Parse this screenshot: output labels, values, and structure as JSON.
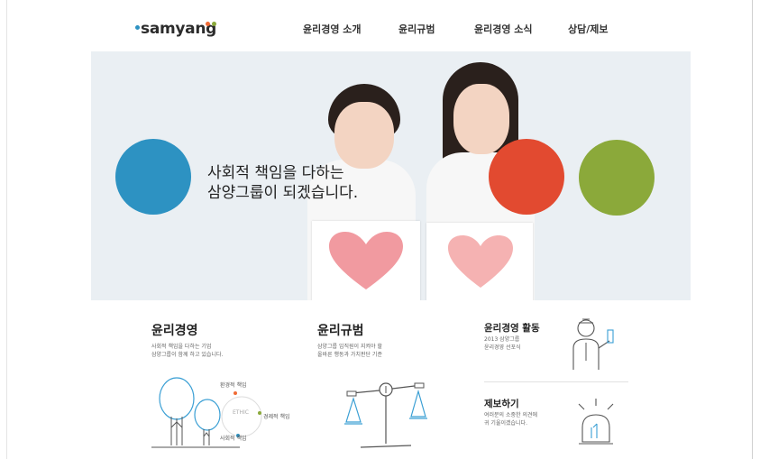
{
  "brand": {
    "logo_text": "samyang",
    "colors": {
      "blue": "#2d92c2",
      "orange": "#f06b35",
      "green": "#8ba93a",
      "red": "#e24a30"
    }
  },
  "nav": {
    "items": [
      {
        "label": "윤리경영 소개"
      },
      {
        "label": "윤리규범"
      },
      {
        "label": "윤리경영 소식"
      },
      {
        "label": "상담/제보"
      }
    ]
  },
  "hero": {
    "headline_line1": "사회적 책임을 다하는",
    "headline_line2": "삼양그룹이 되겠습니다."
  },
  "sections": {
    "ethics": {
      "title": "윤리경영",
      "desc_line1": "사회적 책임을 다하는 기업",
      "desc_line2": "삼양그룹이 함께 하고 있습니다.",
      "diagram": {
        "top": "환경적 책임",
        "center": "ETHIC",
        "right": "경제적 책임",
        "bottom": "사회적 책임"
      }
    },
    "code": {
      "title": "윤리규범",
      "desc_line1": "삼양그룹 임직원이 지켜야 할",
      "desc_line2": "올바른 행동과 가치판단 기준"
    },
    "activity": {
      "title": "윤리경영 활동",
      "desc_line1": "2013 삼양그룹",
      "desc_line2": "윤리경영 선포식"
    },
    "report": {
      "title": "제보하기",
      "desc_line1": "여러분의 소중한 의견에",
      "desc_line2": "귀 기울이겠습니다."
    }
  }
}
